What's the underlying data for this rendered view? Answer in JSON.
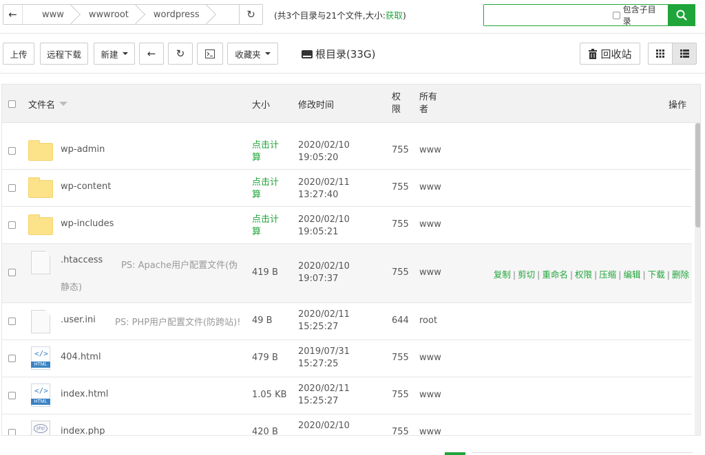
{
  "path": {
    "back_icon": "arrow-left-icon",
    "crumbs": [
      "www",
      "wwwroot",
      "wordpress"
    ],
    "refresh_icon": "refresh-icon"
  },
  "summary": {
    "text": "(共3个目录与21个文件,大小:",
    "link": "获取",
    "end": ")"
  },
  "search": {
    "placeholder": "",
    "subdir_label": "包含子目录",
    "icon": "search-icon"
  },
  "toolbar": {
    "upload": "上传",
    "remote_download": "远程下载",
    "new": "新建",
    "back_icon": "arrow-left-icon",
    "refresh_icon": "refresh-icon",
    "terminal_icon": "terminal-icon",
    "favorites": "收藏夹",
    "root_label": "根目录(33G)",
    "recycle_label": "回收站",
    "grid_icon": "grid-view-icon",
    "list_icon": "list-view-icon"
  },
  "table": {
    "headers": {
      "name": "文件名",
      "size": "大小",
      "mtime": "修改时间",
      "perm": "权限",
      "owner": "所有者",
      "ops": "操作"
    },
    "rows": [
      {
        "type": "folder",
        "name": "wp-admin",
        "size": "点击计算",
        "date": "2020/02/10",
        "time": "19:05:20",
        "perm": "755",
        "owner": "www"
      },
      {
        "type": "folder",
        "name": "wp-content",
        "size": "点击计算",
        "date": "2020/02/11",
        "time": "13:27:40",
        "perm": "755",
        "owner": "www"
      },
      {
        "type": "folder",
        "name": "wp-includes",
        "size": "点击计算",
        "date": "2020/02/10",
        "time": "19:05:21",
        "perm": "755",
        "owner": "www"
      },
      {
        "type": "file",
        "name": ".htaccess",
        "ps": "PS: Apache用户配置文件(伪静态)",
        "size": "419 B",
        "date": "2020/02/10",
        "time": "19:07:37",
        "perm": "755",
        "owner": "www",
        "ops": [
          "复制",
          "剪切",
          "重命名",
          "权限",
          "压缩",
          "编辑",
          "下载",
          "删除"
        ]
      },
      {
        "type": "file",
        "name": ".user.ini",
        "ps": "PS: PHP用户配置文件(防跨站)!",
        "size": "49 B",
        "date": "2020/02/11",
        "time": "15:25:27",
        "perm": "644",
        "owner": "root"
      },
      {
        "type": "html",
        "name": "404.html",
        "size": "479 B",
        "date": "2019/07/31",
        "time": "15:27:25",
        "perm": "755",
        "owner": "www"
      },
      {
        "type": "html",
        "name": "index.html",
        "size": "1.05 KB",
        "date": "2020/02/11",
        "time": "15:25:27",
        "perm": "755",
        "owner": "www"
      },
      {
        "type": "php",
        "name": "index.php",
        "size": "420 B",
        "date": "2020/02/10",
        "time": "",
        "perm": "755",
        "owner": "www"
      }
    ]
  }
}
